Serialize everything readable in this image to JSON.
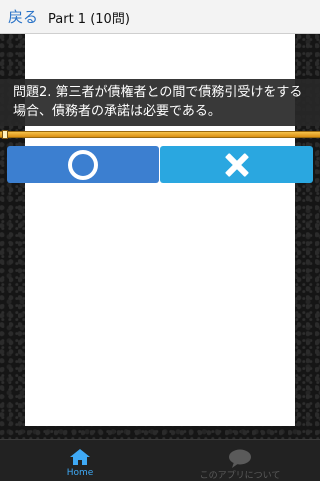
{
  "header": {
    "back_label": "戻る",
    "title": "Part 1 (10問)"
  },
  "question": {
    "text": "問題2. 第三者が債権者との間で債務引受けをする場合、債務者の承諾は必要である。"
  },
  "progress": {
    "fraction": 0.02
  },
  "answers": {
    "true_icon": "circle-icon",
    "false_icon": "cross-icon"
  },
  "colors": {
    "true_button": "#3c7fd0",
    "false_button": "#2aa7e0",
    "active_tab": "#3fa9f5"
  },
  "bottom_nav": {
    "home_label": "Home",
    "about_label": "このアプリについて"
  }
}
